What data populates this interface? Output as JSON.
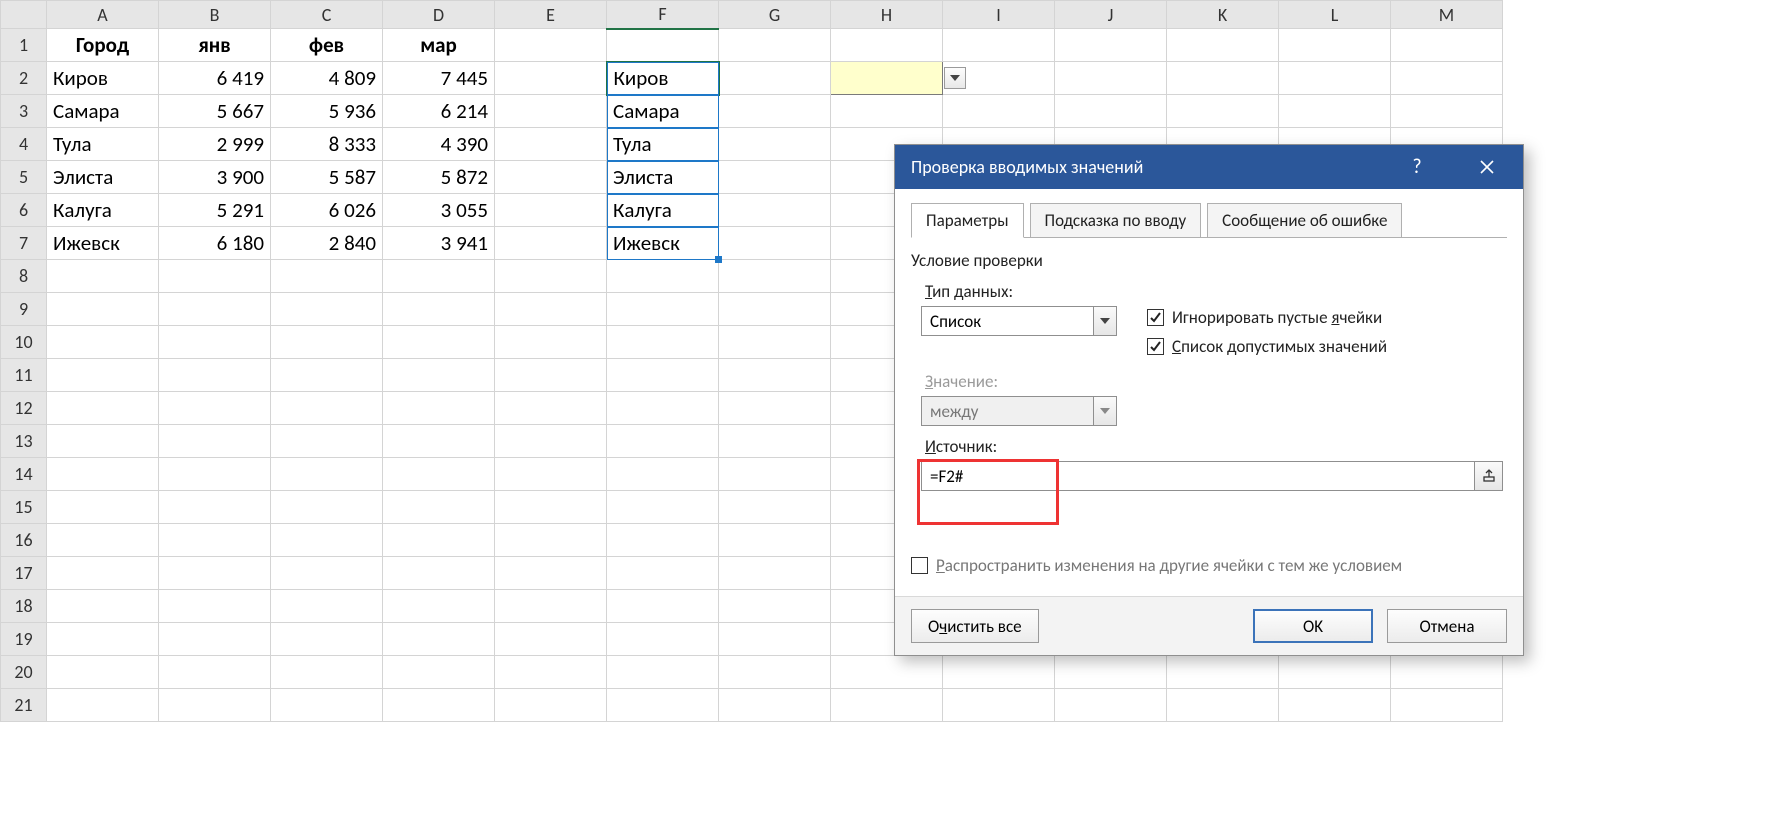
{
  "columns": [
    "A",
    "B",
    "C",
    "D",
    "E",
    "F",
    "G",
    "H",
    "I",
    "J",
    "K",
    "L",
    "M"
  ],
  "rowCount": 21,
  "header": {
    "A": "Город",
    "B": "янв",
    "C": "фев",
    "D": "мар"
  },
  "rows": [
    {
      "city": "Киров",
      "b": "6 419",
      "c": "4 809",
      "d": "7 445"
    },
    {
      "city": "Самара",
      "b": "5 667",
      "c": "5 936",
      "d": "6 214"
    },
    {
      "city": "Тула",
      "b": "2 999",
      "c": "8 333",
      "d": "4 390"
    },
    {
      "city": "Элиста",
      "b": "3 900",
      "c": "5 587",
      "d": "5 872"
    },
    {
      "city": "Калуга",
      "b": "5 291",
      "c": "6 026",
      "d": "3 055"
    },
    {
      "city": "Ижевск",
      "b": "6 180",
      "c": "2 840",
      "d": "3 941"
    }
  ],
  "spill": [
    "Киров",
    "Самара",
    "Тула",
    "Элиста",
    "Калуга",
    "Ижевск"
  ],
  "dialog": {
    "title": "Проверка вводимых значений",
    "tabs": {
      "params": "Параметры",
      "input_msg": "Подсказка по вводу",
      "error_msg": "Сообщение об ошибке"
    },
    "group": "Условие проверки",
    "type_label_pre": "Т",
    "type_label_rest": "ип данных:",
    "type_value": "Список",
    "ignore_pre": "Игнорировать пустые ",
    "ignore_hot": "я",
    "ignore_post": "чейки",
    "listvals_pre": "",
    "listvals_hot": "С",
    "listvals_post": "писок допустимых значений",
    "data_label_pre": "",
    "data_label_hot": "З",
    "data_label_post": "начение:",
    "data_value": "между",
    "source_label_pre": "",
    "source_label_hot": "И",
    "source_label_post": "сточник:",
    "source_value": "=F2#",
    "propagate_pre": "",
    "propagate_hot": "Р",
    "propagate_post": "аспространить изменения на другие ячейки с тем же условием",
    "clear_pre": "О",
    "clear_hot": "ч",
    "clear_post": "истить все",
    "ok": "OK",
    "cancel": "Отмена"
  }
}
